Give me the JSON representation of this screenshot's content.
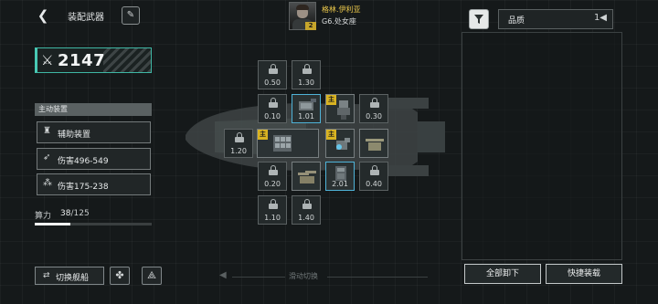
{
  "header": {
    "title": "装配武器",
    "back_icon": "chevron-left-icon",
    "edit_icon": "feather-pen-icon"
  },
  "pilot": {
    "name": "格林.伊利亚",
    "class_text": "G6.处女座",
    "level_badge": "2"
  },
  "filter": {
    "icon": "filter-icon",
    "sort_label": "品质",
    "sort_icon": "sort-toggle-icon"
  },
  "power": {
    "icon": "crossed-swords-icon",
    "value": "2147"
  },
  "active_equipment": {
    "header": "主动装置",
    "items": [
      {
        "icon": "support-device-icon",
        "label": "辅助装置"
      },
      {
        "icon": "missile-damage-icon",
        "label": "伤害496-549"
      },
      {
        "icon": "gun-damage-icon",
        "label": "伤害175-238"
      }
    ]
  },
  "compute": {
    "label": "算力",
    "used": "38",
    "separator": "/",
    "total": "125",
    "fill_fraction": 0.304
  },
  "bottom": {
    "switch_ship_label": "切换舰船",
    "switch_icon": "swap-arrows-icon",
    "round_btn_1_icon": "emblem-icon",
    "round_btn_2_icon": "triangle-emblem-icon",
    "swipe_hint": "滑动切换",
    "unload_all_label": "全部卸下",
    "quick_equip_label": "快捷装载"
  },
  "slots": {
    "main_tag": "主",
    "locked": {
      "r1a": "0.50",
      "r1b": "1.30",
      "r2a": "0.10",
      "r2d": "0.30",
      "r3a": "1.20",
      "r4a": "0.20",
      "r4d": "0.40",
      "r5a": "1.10",
      "r5b": "1.40"
    },
    "filled": {
      "r2b": "1.01",
      "r4c": "2.01"
    }
  },
  "colors": {
    "accent_teal": "#48c9b4",
    "main_tag_yellow": "#d9b322",
    "pilot_name_gold": "#e9c64a",
    "selected_slot_blue": "#4fb3d8"
  }
}
